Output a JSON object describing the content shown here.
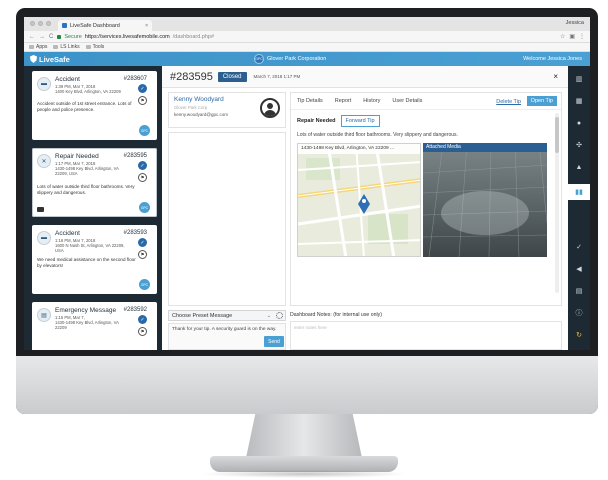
{
  "browser": {
    "tab_title": "LiveSafe Dashboard",
    "tab_close": "×",
    "profile_name": "Jessica",
    "secure_label": "Secure",
    "url_host": "https://services.livesafemobile.com",
    "url_path": "/dashboard.php#",
    "bookmarks": [
      "Apps",
      "LS Links",
      "Tools"
    ]
  },
  "app_header": {
    "logo_text": "LiveSafe",
    "org_badge": "GPC",
    "org_name": "Glover Park Corporation",
    "welcome": "Welcome Jessica Jones"
  },
  "tips": [
    {
      "type": "Accident",
      "number": "#283607",
      "time": "1:39 PM, Mar 7, 2018",
      "address": "1400 Key Blvd, Arlington, VA 22209",
      "description": "Accident outside of 1st street entrance. Lots of people and police presence.",
      "badge": "GPC"
    },
    {
      "type": "Repair Needed",
      "number": "#283595",
      "time": "1:17 PM, Mar 7, 2018",
      "address": "1430-1498 Key Blvd, Arlington, VA 22209, USA",
      "description": "Lots of water outside third floor bathrooms. Very slippery and dangerous.",
      "badge": "GPC"
    },
    {
      "type": "Accident",
      "number": "#283593",
      "time": "1:16 PM, Mar 7, 2018",
      "address": "1600 N Nash St, Arlington, VA 22209, USA",
      "description": "We need medical assistance on the second floor by elevators!",
      "badge": "GPC"
    },
    {
      "type": "Emergency Message",
      "number": "#283592",
      "time": "1:15 PM, Mar 7,",
      "address": "1430-1498 Key Blvd, Arlington, VA 22209",
      "description": "",
      "badge": ""
    }
  ],
  "detail": {
    "tip_number": "#283595",
    "status": "Closed",
    "timestamp": "March 7, 2018 1:17 PM",
    "close_icon": "×",
    "contact": {
      "name": "Kenny Woodyard",
      "org": "Glover Park Corp",
      "email": "kenny.woodyard@gpc.com"
    },
    "tabs": [
      "Tip Details",
      "Report",
      "History",
      "User Details"
    ],
    "delete_tip": "Delete Tip",
    "open_tip": "Open Tip",
    "category": "Repair Needed",
    "forward_tip": "Forward Tip",
    "description": "Lots of water outside third floor bathrooms. Very slippery and dangerous.",
    "map_address": "1430-1498 Key Blvd, Arlington, VA 22209 ...",
    "media_title": "Attached Media",
    "preset_placeholder": "Choose Preset Message",
    "message_text": "Thank for your tip. A security guard is on the way.",
    "send_label": "Send",
    "notes_label": "Dashboard Notes: (for internal use only)",
    "notes_placeholder": "enter notes here"
  },
  "colors": {
    "header_blue": "#3c93c9",
    "sidebar_dark": "#1e2a33",
    "status_closed": "#2c5f90",
    "accent": "#4aa0d3"
  }
}
